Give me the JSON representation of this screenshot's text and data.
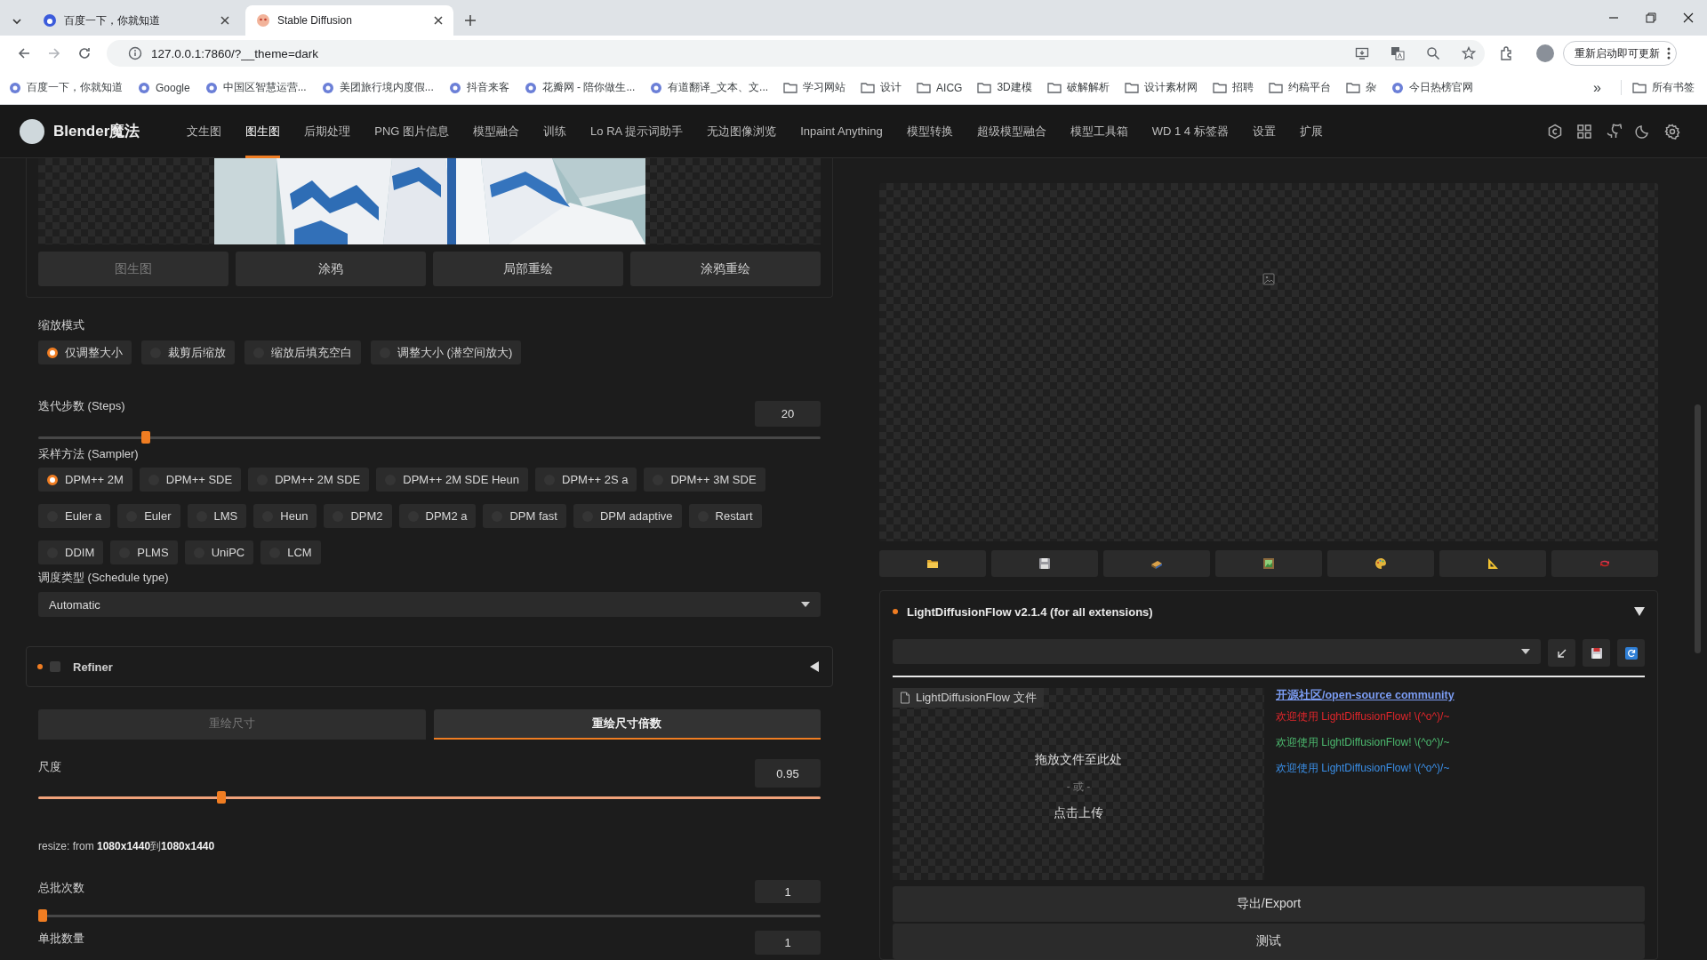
{
  "browser": {
    "tabs": [
      {
        "title": "百度一下，你就知道",
        "selected": false
      },
      {
        "title": "Stable Diffusion",
        "selected": true
      }
    ],
    "address": "127.0.0.1:7860/?__theme=dark",
    "update_button": "重新启动即可更新",
    "bookmarks": [
      {
        "label": "百度一下，你就知道",
        "kind": "site"
      },
      {
        "label": "Google",
        "kind": "site"
      },
      {
        "label": "中国区智慧运营...",
        "kind": "site"
      },
      {
        "label": "美团旅行境内度假...",
        "kind": "site"
      },
      {
        "label": "抖音来客",
        "kind": "site"
      },
      {
        "label": "花瓣网 - 陪你做生...",
        "kind": "site"
      },
      {
        "label": "有道翻译_文本、文...",
        "kind": "site"
      },
      {
        "label": "学习网站",
        "kind": "folder"
      },
      {
        "label": "设计",
        "kind": "folder"
      },
      {
        "label": "AICG",
        "kind": "folder"
      },
      {
        "label": "3D建模",
        "kind": "folder"
      },
      {
        "label": "破解解析",
        "kind": "folder"
      },
      {
        "label": "设计素材网",
        "kind": "folder"
      },
      {
        "label": "招聘",
        "kind": "folder"
      },
      {
        "label": "约稿平台",
        "kind": "folder"
      },
      {
        "label": "杂",
        "kind": "folder"
      },
      {
        "label": "今日热榜官网",
        "kind": "site"
      }
    ],
    "more_bookmarks": "»",
    "all_bookmarks": "所有书签"
  },
  "app": {
    "brand": "Blender魔法",
    "nav": [
      {
        "label": "文生图",
        "selected": false
      },
      {
        "label": "图生图",
        "selected": true
      },
      {
        "label": "后期处理",
        "selected": false
      },
      {
        "label": "PNG 图片信息",
        "selected": false
      },
      {
        "label": "模型融合",
        "selected": false
      },
      {
        "label": "训练",
        "selected": false
      },
      {
        "label": "Lo RA 提示词助手",
        "selected": false
      },
      {
        "label": "无边图像浏览",
        "selected": false
      },
      {
        "label": "Inpaint Anything",
        "selected": false
      },
      {
        "label": "模型转换",
        "selected": false
      },
      {
        "label": "超级模型融合",
        "selected": false
      },
      {
        "label": "模型工具箱",
        "selected": false
      },
      {
        "label": "WD 1 4 标签器",
        "selected": false
      },
      {
        "label": "设置",
        "selected": false
      },
      {
        "label": "扩展",
        "selected": false
      }
    ]
  },
  "left": {
    "mode_tabs": [
      {
        "label": "图生图",
        "selected": true
      },
      {
        "label": "涂鸦",
        "selected": false
      },
      {
        "label": "局部重绘",
        "selected": false
      },
      {
        "label": "涂鸦重绘",
        "selected": false
      }
    ],
    "resize_mode": {
      "label": "缩放模式",
      "options": [
        {
          "label": "仅调整大小",
          "selected": true
        },
        {
          "label": "裁剪后缩放",
          "selected": false
        },
        {
          "label": "缩放后填充空白",
          "selected": false
        },
        {
          "label": "调整大小 (潜空间放大)",
          "selected": false
        }
      ]
    },
    "steps": {
      "label": "迭代步数 (Steps)",
      "value": "20",
      "level": 0.133
    },
    "sampler": {
      "label": "采样方法 (Sampler)",
      "options": [
        {
          "label": "DPM++ 2M",
          "selected": true
        },
        {
          "label": "DPM++ SDE",
          "selected": false
        },
        {
          "label": "DPM++ 2M SDE",
          "selected": false
        },
        {
          "label": "DPM++ 2M SDE Heun",
          "selected": false
        },
        {
          "label": "DPM++ 2S a",
          "selected": false
        },
        {
          "label": "DPM++ 3M SDE",
          "selected": false
        },
        {
          "label": "Euler a",
          "selected": false
        },
        {
          "label": "Euler",
          "selected": false
        },
        {
          "label": "LMS",
          "selected": false
        },
        {
          "label": "Heun",
          "selected": false
        },
        {
          "label": "DPM2",
          "selected": false
        },
        {
          "label": "DPM2 a",
          "selected": false
        },
        {
          "label": "DPM fast",
          "selected": false
        },
        {
          "label": "DPM adaptive",
          "selected": false
        },
        {
          "label": "Restart",
          "selected": false
        },
        {
          "label": "DDIM",
          "selected": false
        },
        {
          "label": "PLMS",
          "selected": false
        },
        {
          "label": "UniPC",
          "selected": false
        },
        {
          "label": "LCM",
          "selected": false
        }
      ]
    },
    "schedule": {
      "label": "调度类型 (Schedule type)",
      "value": "Automatic"
    },
    "refiner": {
      "label": "Refiner",
      "checked": false,
      "expanded": false
    },
    "size_tabs": [
      {
        "label": "重绘尺寸",
        "selected": false
      },
      {
        "label": "重绘尺寸倍数",
        "selected": true
      }
    ],
    "scale": {
      "label": "尺度",
      "value": "0.95",
      "level": 0.231
    },
    "resize_note": "resize: from **1080x1440**到**1080x1440**",
    "batch_count": {
      "label": "总批次数",
      "value": "1",
      "level": 0
    },
    "batch_size": {
      "label": "单批数量",
      "value": "1"
    }
  },
  "right": {
    "flow": {
      "title": "LightDiffusionFlow v2.1.4 (for all extensions)",
      "expanded": true,
      "file_label": "LightDiffusionFlow 文件",
      "drop_text": "拖放文件至此处",
      "or_text": "- 或 -",
      "upload_text": "点击上传",
      "link": "开源社区/open-source community",
      "messages": [
        {
          "text": "欢迎使用 LightDiffusionFlow! \\(^o^)/~",
          "color": "#e0262b"
        },
        {
          "text": "欢迎使用 LightDiffusionFlow! \\(^o^)/~",
          "color": "#4cb86e"
        },
        {
          "text": "欢迎使用 LightDiffusionFlow! \\(^o^)/~",
          "color": "#3a8ee6"
        }
      ],
      "export_button": "导出/Export",
      "test_button": "测试"
    }
  }
}
